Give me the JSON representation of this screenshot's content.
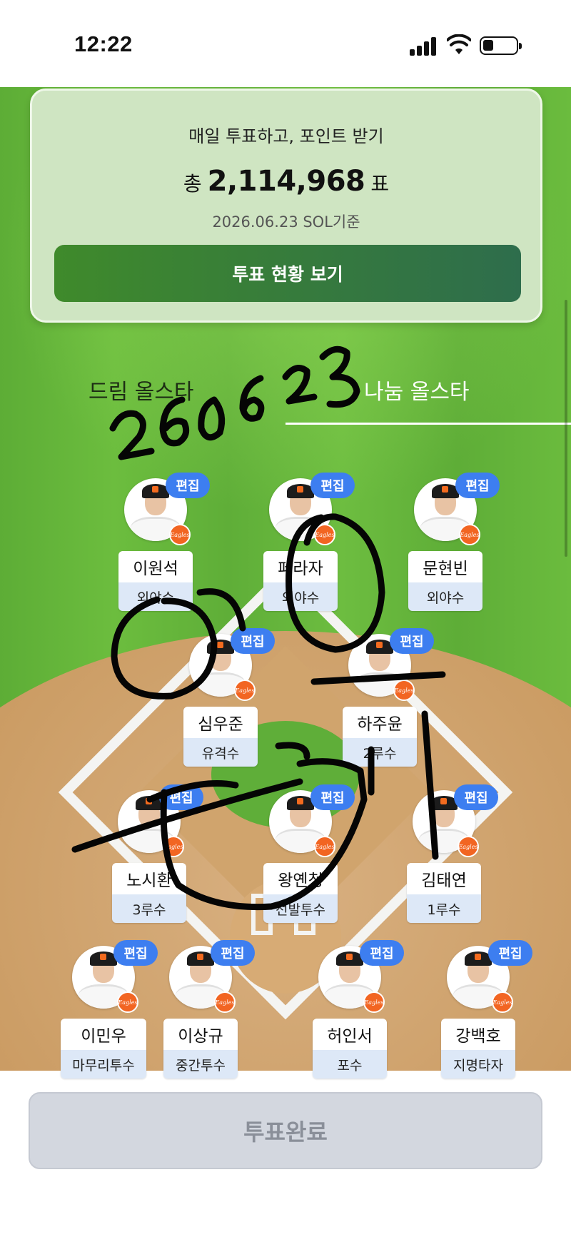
{
  "status_bar": {
    "time": "12:22"
  },
  "vote_card": {
    "title": "매일 투표하고, 포인트 받기",
    "count_prefix": "총",
    "count": "2,114,968",
    "count_suffix": "표",
    "date": "2026.06.23 SOL기준",
    "view_button": "투표 현황 보기"
  },
  "tabs": {
    "dream": "드림 올스타",
    "share": "나눔 올스타",
    "active": "share"
  },
  "edit_label": "편집",
  "logo_text": "Eagles",
  "players": [
    {
      "name": "이원석",
      "position": "외야수"
    },
    {
      "name": "페라자",
      "position": "외야수"
    },
    {
      "name": "문현빈",
      "position": "외야수"
    },
    {
      "name": "심우준",
      "position": "유격수"
    },
    {
      "name": "하주윤",
      "position": "2루수"
    },
    {
      "name": "노시환",
      "position": "3루수"
    },
    {
      "name": "왕옌청",
      "position": "선발투수"
    },
    {
      "name": "김태연",
      "position": "1루수"
    },
    {
      "name": "이민우",
      "position": "마무리투수"
    },
    {
      "name": "이상규",
      "position": "중간투수"
    },
    {
      "name": "허인서",
      "position": "포수"
    },
    {
      "name": "강백호",
      "position": "지명타자"
    }
  ],
  "complete_button": "투표완료",
  "handwriting": "260623",
  "colors": {
    "edit_badge": "#3d7ef0",
    "primary_button": "#3f8a2b",
    "logo_badge": "#f26522",
    "disabled_button": "#d3d7df"
  }
}
